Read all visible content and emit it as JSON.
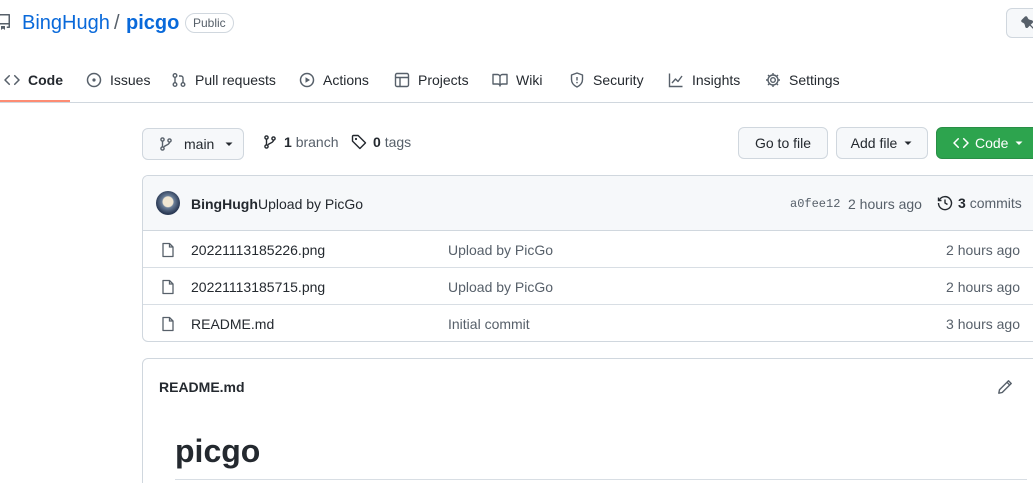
{
  "repo": {
    "owner": "BingHugh",
    "separator": "/",
    "name": "picgo",
    "visibility": "Public"
  },
  "nav": {
    "tabs": [
      {
        "label": "Code",
        "icon": "code-icon",
        "active": true
      },
      {
        "label": "Issues",
        "icon": "issue-icon"
      },
      {
        "label": "Pull requests",
        "icon": "pull-request-icon"
      },
      {
        "label": "Actions",
        "icon": "play-icon"
      },
      {
        "label": "Projects",
        "icon": "table-icon"
      },
      {
        "label": "Wiki",
        "icon": "book-icon"
      },
      {
        "label": "Security",
        "icon": "shield-icon"
      },
      {
        "label": "Insights",
        "icon": "graph-icon"
      },
      {
        "label": "Settings",
        "icon": "gear-icon"
      }
    ]
  },
  "toolbar": {
    "branch": "main",
    "branch_count": "1",
    "branch_label": "branch",
    "tag_count": "0",
    "tag_label": "tags",
    "go_to_file": "Go to file",
    "add_file": "Add file",
    "code": "Code"
  },
  "commit": {
    "author": "BingHugh",
    "message": "Upload by PicGo",
    "sha": "a0fee12",
    "time": "2 hours ago",
    "count": "3",
    "count_label": "commits"
  },
  "files": [
    {
      "name": "20221113185226.png",
      "message": "Upload by PicGo",
      "time": "2 hours ago"
    },
    {
      "name": "20221113185715.png",
      "message": "Upload by PicGo",
      "time": "2 hours ago"
    },
    {
      "name": "README.md",
      "message": "Initial commit",
      "time": "3 hours ago"
    }
  ],
  "readme": {
    "filename": "README.md",
    "heading": "picgo"
  },
  "colors": {
    "link": "#0969da",
    "primary_button": "#2da44e",
    "active_tab_underline": "#fd8c73"
  }
}
